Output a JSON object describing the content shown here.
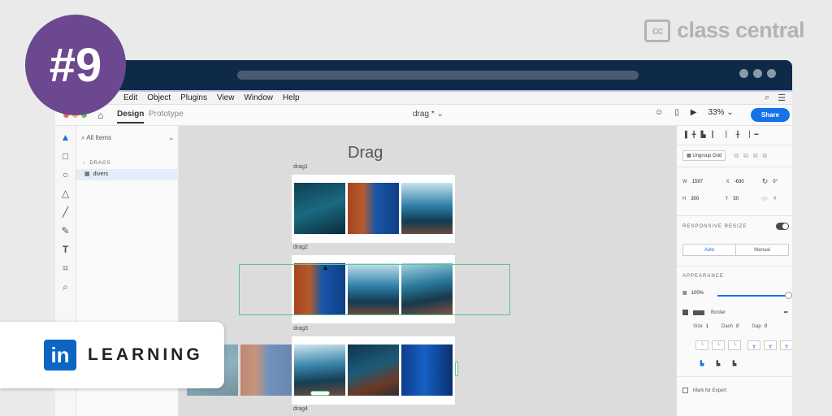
{
  "brand": {
    "cc_mark": "cc",
    "cc_name": "class central"
  },
  "badge": {
    "rank": "#9"
  },
  "linkedin": {
    "mark": "in",
    "label": "LEARNING"
  },
  "menu": {
    "items": [
      "Edit",
      "Object",
      "Plugins",
      "View",
      "Window",
      "Help"
    ]
  },
  "toolbar": {
    "design_tab": "Design",
    "prototype_tab": "Prototype",
    "doc_title": "drag *",
    "zoom": "33%",
    "share_label": "Share"
  },
  "layers": {
    "search_placeholder": "All Items",
    "group_label": "DRAGS",
    "selected_item": "divers"
  },
  "canvas": {
    "title": "Drag",
    "artboards": [
      "drag1",
      "drag2",
      "drag3",
      "drag4"
    ]
  },
  "props": {
    "ungroup_label": "Ungroup Grid",
    "w_label": "W",
    "w_value": "1597",
    "x_label": "X",
    "x_value": "-630",
    "rot_value": "0°",
    "h_label": "H",
    "h_value": "300",
    "y_label": "Y",
    "y_value": "50",
    "responsive_label": "RESPONSIVE RESIZE",
    "auto_label": "Auto",
    "manual_label": "Manual",
    "appearance_label": "APPEARANCE",
    "opacity_value": "100%",
    "border_label": "Border",
    "size_label": "Size",
    "size_value": "1",
    "dash_label": "Dash",
    "dash_value": "0",
    "gap_label": "Gap",
    "gap_value": "0",
    "export_label": "Mark for Export"
  },
  "colors": {
    "titlebar": "#0f2a48",
    "accent": "#1473e6",
    "badge": "#6b488f",
    "linkedin": "#0a66c2",
    "selection": "#5fc38a"
  }
}
